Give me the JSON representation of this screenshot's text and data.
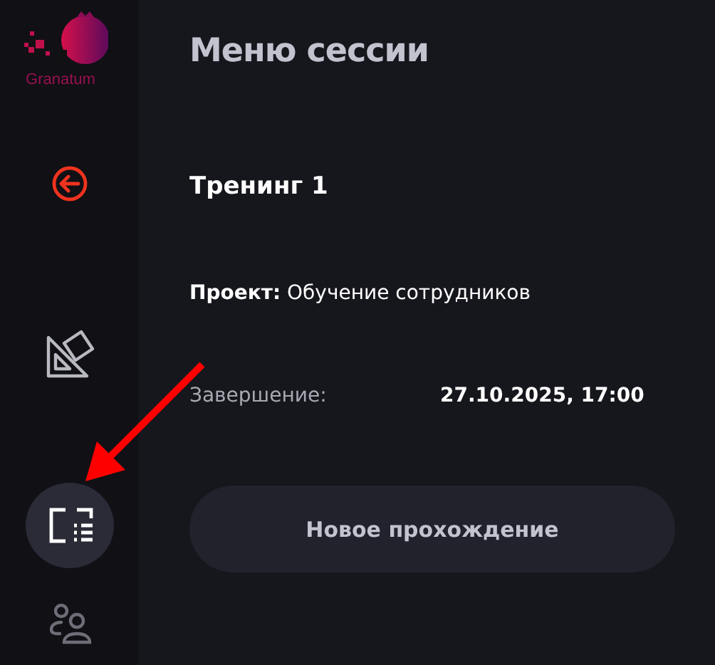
{
  "sidebar": {
    "logo": {
      "text": "Granatum"
    },
    "items": [
      {
        "kind": "back",
        "selected": false
      },
      {
        "kind": "tools",
        "selected": false
      },
      {
        "kind": "session",
        "selected": true
      },
      {
        "kind": "people",
        "selected": false
      }
    ]
  },
  "main": {
    "title": "Меню сессии",
    "session_name": "Тренинг 1",
    "project": {
      "label": "Проект:",
      "value": "Обучение сотрудников"
    },
    "end": {
      "label": "Завершение:",
      "value": "27.10.2025, 17:00"
    },
    "button": "Новое прохождение"
  }
}
